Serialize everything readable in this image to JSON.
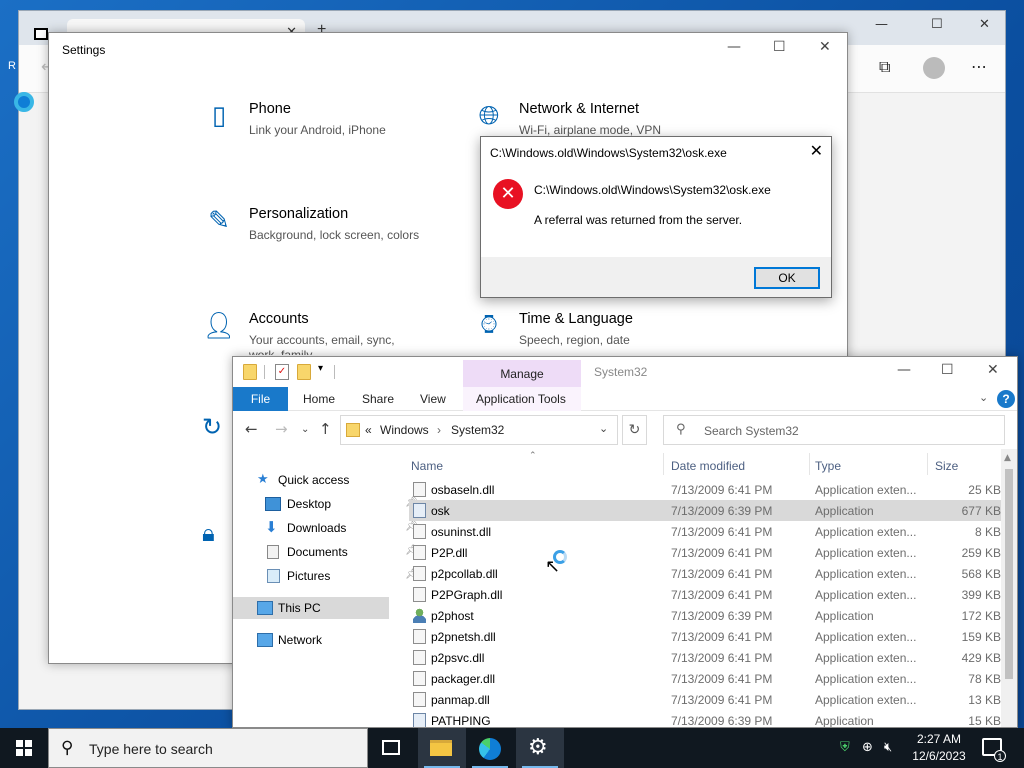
{
  "desktop": {
    "left_label": "R"
  },
  "settings": {
    "title": "Settings",
    "items": [
      {
        "name": "Phone",
        "desc": "Link your Android, iPhone",
        "icon": "phone-icon"
      },
      {
        "name": "Network & Internet",
        "desc": "Wi-Fi, airplane mode, VPN",
        "icon": "globe-icon"
      },
      {
        "name": "Personalization",
        "desc": "Background, lock screen, colors",
        "icon": "personalization-icon"
      },
      {
        "name": "Accounts",
        "desc": "Your accounts, email, sync, work, family",
        "icon": "person-icon"
      },
      {
        "name": "Time & Language",
        "desc": "Speech, region, date",
        "icon": "time-language-icon"
      }
    ]
  },
  "dialog": {
    "title": "C:\\Windows.old\\Windows\\System32\\osk.exe",
    "path": "C:\\Windows.old\\Windows\\System32\\osk.exe",
    "message": "A referral was returned from the server.",
    "ok_label": "OK"
  },
  "explorer": {
    "title": "System32",
    "manage_label": "Manage",
    "ribbon_tabs": {
      "file": "File",
      "home": "Home",
      "share": "Share",
      "view": "View",
      "app_tools": "Application Tools"
    },
    "address": {
      "prefix": "«",
      "crumbs": [
        "Windows",
        "System32"
      ]
    },
    "search_placeholder": "Search System32",
    "nav": {
      "quick_access": "Quick access",
      "desktop": "Desktop",
      "downloads": "Downloads",
      "documents": "Documents",
      "pictures": "Pictures",
      "this_pc": "This PC",
      "network": "Network"
    },
    "columns": {
      "name": "Name",
      "date": "Date modified",
      "type": "Type",
      "size": "Size"
    },
    "files": [
      {
        "name": "osbaseln.dll",
        "date": "7/13/2009 6:41 PM",
        "type": "Application exten...",
        "size": "25 KB",
        "kind": "dll"
      },
      {
        "name": "osk",
        "date": "7/13/2009 6:39 PM",
        "type": "Application",
        "size": "677 KB",
        "kind": "app"
      },
      {
        "name": "osuninst.dll",
        "date": "7/13/2009 6:41 PM",
        "type": "Application exten...",
        "size": "8 KB",
        "kind": "dll"
      },
      {
        "name": "P2P.dll",
        "date": "7/13/2009 6:41 PM",
        "type": "Application exten...",
        "size": "259 KB",
        "kind": "dll"
      },
      {
        "name": "p2pcollab.dll",
        "date": "7/13/2009 6:41 PM",
        "type": "Application exten...",
        "size": "568 KB",
        "kind": "dll"
      },
      {
        "name": "P2PGraph.dll",
        "date": "7/13/2009 6:41 PM",
        "type": "Application exten...",
        "size": "399 KB",
        "kind": "dll"
      },
      {
        "name": "p2phost",
        "date": "7/13/2009 6:39 PM",
        "type": "Application",
        "size": "172 KB",
        "kind": "person"
      },
      {
        "name": "p2pnetsh.dll",
        "date": "7/13/2009 6:41 PM",
        "type": "Application exten...",
        "size": "159 KB",
        "kind": "dll"
      },
      {
        "name": "p2psvc.dll",
        "date": "7/13/2009 6:41 PM",
        "type": "Application exten...",
        "size": "429 KB",
        "kind": "dll"
      },
      {
        "name": "packager.dll",
        "date": "7/13/2009 6:41 PM",
        "type": "Application exten...",
        "size": "78 KB",
        "kind": "dll"
      },
      {
        "name": "panmap.dll",
        "date": "7/13/2009 6:41 PM",
        "type": "Application exten...",
        "size": "13 KB",
        "kind": "dll"
      },
      {
        "name": "PATHPING",
        "date": "7/13/2009 6:39 PM",
        "type": "Application",
        "size": "15 KB",
        "kind": "app"
      }
    ],
    "selected_file": "osk"
  },
  "taskbar": {
    "search_placeholder": "Type here to search",
    "time": "2:27 AM",
    "date": "12/6/2023",
    "notification_count": "1"
  }
}
